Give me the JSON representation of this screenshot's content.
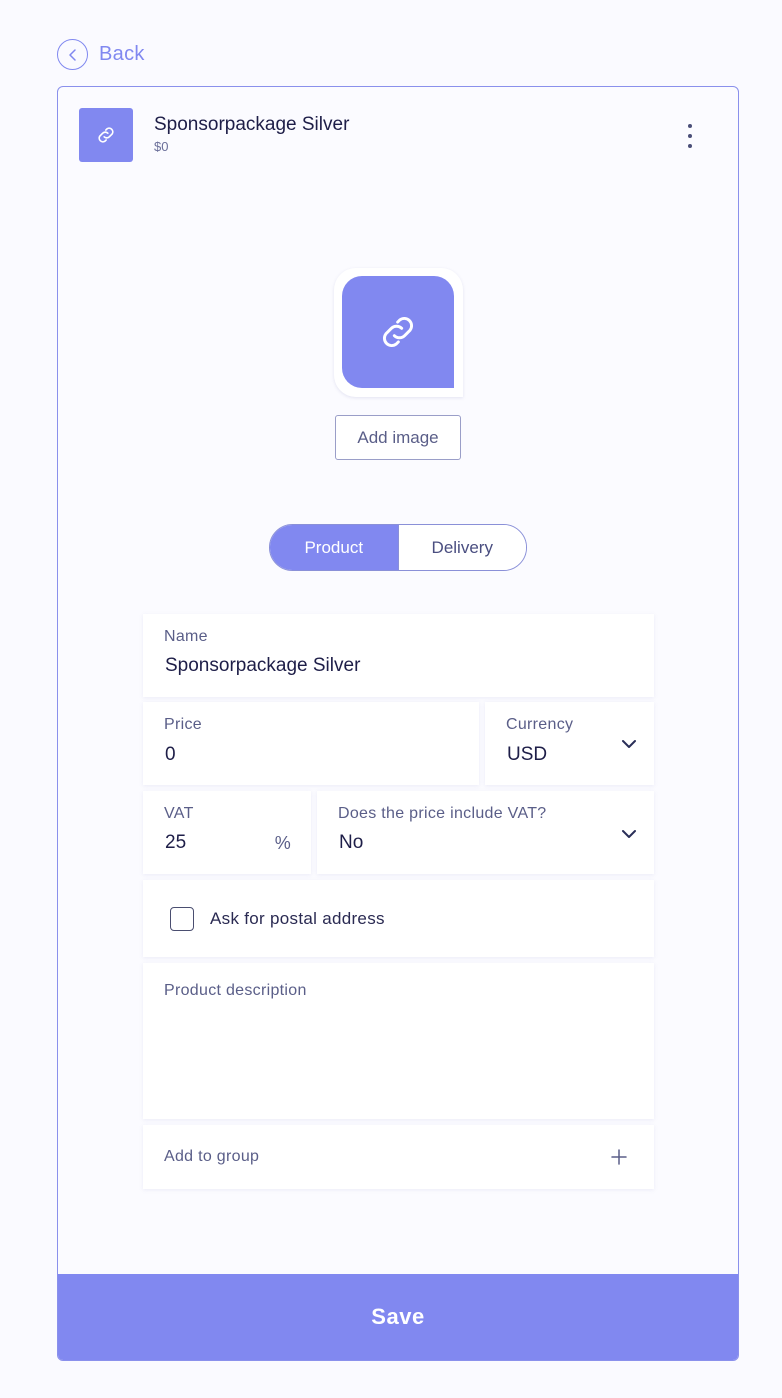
{
  "back": {
    "label": "Back"
  },
  "header": {
    "title": "Sponsorpackage Silver",
    "price": "$0"
  },
  "image": {
    "add_label": "Add image"
  },
  "tabs": [
    {
      "label": "Product",
      "active": true
    },
    {
      "label": "Delivery",
      "active": false
    }
  ],
  "form": {
    "name": {
      "label": "Name",
      "value": "Sponsorpackage Silver"
    },
    "price": {
      "label": "Price",
      "value": "0"
    },
    "currency": {
      "label": "Currency",
      "value": "USD"
    },
    "vat": {
      "label": "VAT",
      "value": "25",
      "unit": "%"
    },
    "vat_included": {
      "label": "Does the price include VAT?",
      "value": "No"
    },
    "postal": {
      "label": "Ask for postal address",
      "checked": false
    },
    "description": {
      "label": "Product description",
      "value": ""
    },
    "group": {
      "label": "Add to group"
    }
  },
  "save": {
    "label": "Save"
  },
  "colors": {
    "accent": "#8188f0",
    "text": "#1e1e48"
  },
  "icons": [
    "chevron-left-icon",
    "link-icon",
    "more-vertical-icon",
    "chevron-down-icon",
    "plus-icon"
  ]
}
